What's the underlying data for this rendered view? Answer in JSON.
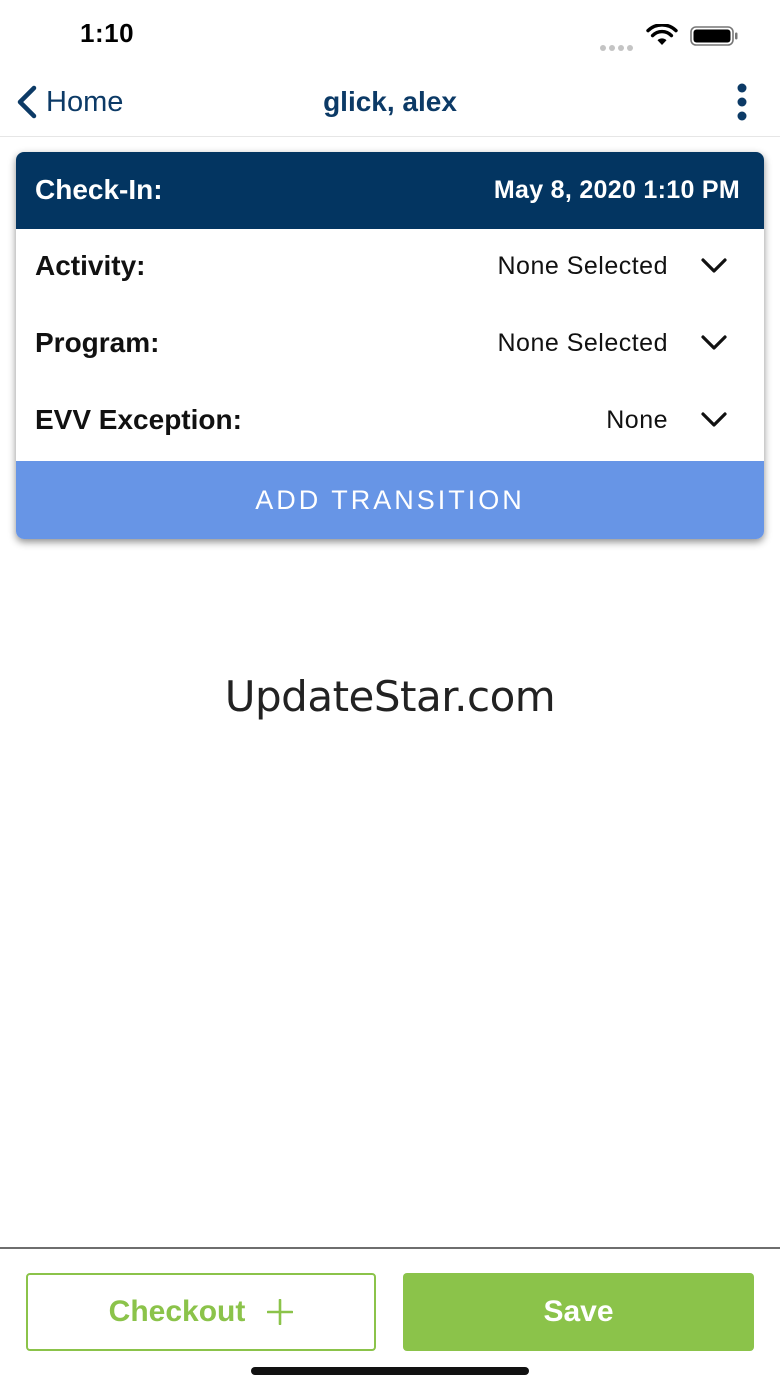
{
  "status_bar": {
    "time": "1:10"
  },
  "nav": {
    "back_label": "Home",
    "title": "glick, alex"
  },
  "card": {
    "header_label": "Check-In:",
    "header_date": "May 8, 2020 1:10 PM",
    "fields": [
      {
        "label": "Activity:",
        "value": "None Selected"
      },
      {
        "label": "Program:",
        "value": "None Selected"
      },
      {
        "label": "EVV Exception:",
        "value": "None"
      }
    ],
    "add_transition_label": "ADD TRANSITION"
  },
  "watermark": "UpdateStar.com",
  "footer": {
    "checkout_label": "Checkout",
    "save_label": "Save"
  },
  "colors": {
    "navy": "#033561",
    "link": "#0c3a66",
    "transition_blue": "#6795e6",
    "green": "#8bc34a"
  }
}
